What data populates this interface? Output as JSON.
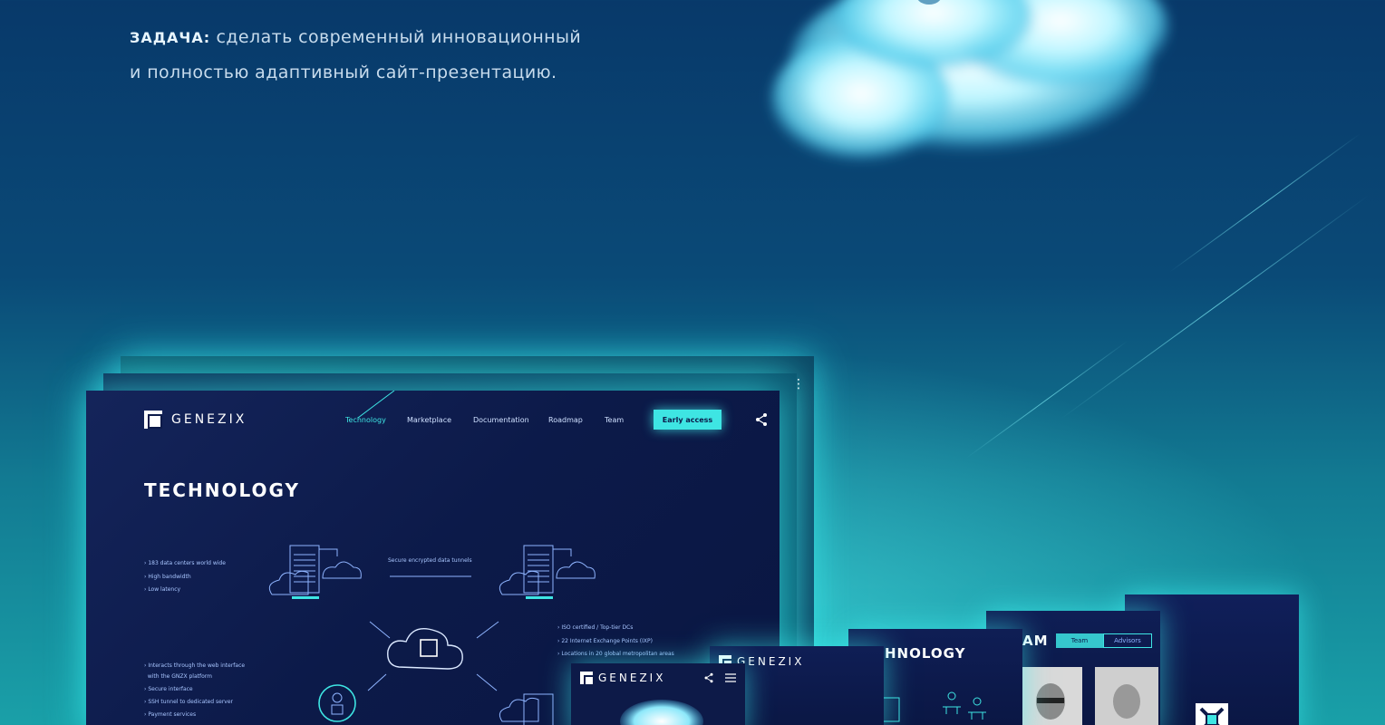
{
  "task": {
    "label": "ЗАДАЧА:",
    "line1": "сделать современный инновационный",
    "line2": "и полностью адаптивный сайт-презентацию."
  },
  "site": {
    "brand": "GENEZIX",
    "nav": [
      "Technology",
      "Marketplace",
      "Documentation",
      "Roadmap",
      "Team"
    ],
    "cta": "Early access",
    "title": "TECHNOLOGY",
    "features_top": [
      "183 data centers world wide",
      "High bandwidth",
      "Low latency"
    ],
    "tunnel_caption": "Secure encrypted data tunnels",
    "features_right": [
      "ISO certified / Top-tier DCs",
      "22 Internet Exchange Points (IXP)",
      "Locations in 20 global metropolitan areas"
    ],
    "features_bottom": [
      "Interacts through the web interface",
      "with the GNZX platform",
      "Secure interface",
      "SSH tunnel to dedicated server",
      "Payment services"
    ]
  },
  "mobile": {
    "tech_fragment": "HNOLOGY",
    "team_fragment": "AM",
    "team_tabs": [
      "Team",
      "Advisors"
    ]
  },
  "colors": {
    "accent": "#3ee5e3",
    "panel": "#0c1a49",
    "bg_top": "#08396a",
    "bg_bottom": "#1aa0a8"
  }
}
